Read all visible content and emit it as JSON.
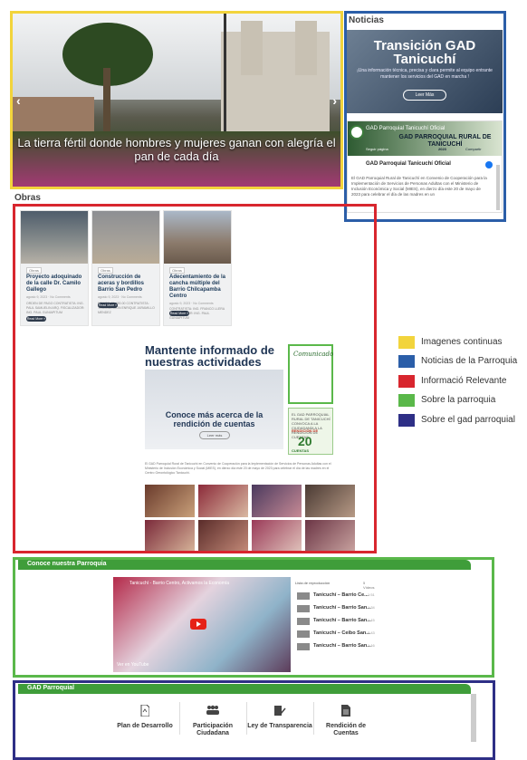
{
  "hero": {
    "caption": "La tierra fértil donde hombres y mujeres ganan con alegría el pan de cada día",
    "prev_arrow": "‹",
    "next_arrow": "›"
  },
  "noticias": {
    "title": "Noticias",
    "banner_title": "Transición GAD Tanicuchí",
    "banner_subtitle": "¡Una información técnica, precisa y clara permite al equipo entrante mantener los servicios del GAD en marcha !",
    "banner_button": "Leer Más",
    "fb_page_name": "GAD Parroquial Tanicuchí Oficial",
    "fb_headline": "GAD PARROQUIAL RURAL DE TANICUCHÍ",
    "fb_follow": "Seguir página",
    "fb_share": "Compartir",
    "fb_year": "2023",
    "fb_post_author": "GAD Parroquial Tanicuchí Oficial",
    "fb_post_text": "El GAD Parroquial Rural de Tanicuchí en Convenio de Cooperación para la Implementación de Servicios de Personas Adultas con el Ministerio de Inclusión Económica y Social (MIES), en dierzo día este 20 de mayo de 2023 para celebrar el día de las madres en un"
  },
  "obras": {
    "title": "Obras",
    "read_more": "Read More »",
    "cards": [
      {
        "tag": "Obras",
        "title": "Proyecto adoquinado de la calle Dr. Camilo Gallego",
        "meta": "agosto 9, 2023 · No Comments",
        "text": "ORDEN DE PAGO CONTRATISTA: ING. PAUL SAMUELIN ARQ. FISCALIZADOR: ING. PAUL GUNIAPITUM"
      },
      {
        "tag": "Obras",
        "title": "Construcción de aceras y bordillos Barrio San Pedro",
        "meta": "agosto 9, 2023 · No Comments",
        "text": "MONTO: 51,490.00 CONTRATISTA: TRANSACCIÓN ENRIQUE JARAMILLO MENDEZ"
      },
      {
        "tag": "Obras",
        "title": "Adecentamiento de la cancha múltiple del Barrio Chilcapamba Centro",
        "meta": "agosto 9, 2023 · No Comments",
        "text": "CONTRATISTA: ING. FRANCO LLERA FISCALIZADOR: ING. PAUL GUNIAPITUM"
      }
    ]
  },
  "informacion": {
    "heading": "Mantente informado de nuestras actividades",
    "rendicion_title": "Conoce más acerca de la rendición de cuentas",
    "rendicion_button": "Leer más",
    "comunicado": "Comunicado",
    "poster_text": "EL GAD PARROQUIAL RURAL DE TANICUCHÍ CONVOCA A LA CIUDADANÍA A LA RENDICIÓN DE CUENTAS",
    "poster_label": "RENDICIÓN DE",
    "poster_number": "20",
    "poster_sub": "CUENTAS",
    "paragraph": "El GAD Parroquial Rural de Tanicuchí en Convenio de Cooperación para la Implementación de Servicios de Personas Adultas con el Ministerio de Inclusión Económica y Social (MIES), en dierzo día este 20 de mayo de 2023 para celebrar el día de las madres en el Centro Gerontológico Tanicuchí."
  },
  "legend": [
    {
      "label": "Imagenes continuas",
      "color": "#f2d43c"
    },
    {
      "label": "Noticias de la Parroquia",
      "color": "#2b5ea8"
    },
    {
      "label": "Informació Relevante",
      "color": "#d8262e"
    },
    {
      "label": "Sobre la parroquia",
      "color": "#5ab84a"
    },
    {
      "label": "Sobre el gad parroquial",
      "color": "#2e2f86"
    }
  ],
  "parroquia": {
    "title": "Conoce nuestra Parroquia",
    "video_title": "Tanicuchí - Barrio Centro, Activamos la Economía",
    "watch_on": "Ver en YouTube",
    "playlist_header": "Lista de reproducción",
    "playlist_count": "5 Vídeos",
    "playlist": [
      {
        "title": "Tanicuchí – Barrio Ce...",
        "duration": "1:51"
      },
      {
        "title": "Tanicuchí – Barrio San...",
        "duration": "1:34"
      },
      {
        "title": "Tanicuchí – Barrio San...",
        "duration": "1:15"
      },
      {
        "title": "Tanicuchí – Ceibo San...",
        "duration": "0:43"
      },
      {
        "title": "Tanicuchí – Barrio San...",
        "duration": "1:16"
      }
    ]
  },
  "gad": {
    "title": "GAD Parroquial",
    "items": [
      {
        "label": "Plan de Desarrollo",
        "icon": "document-icon"
      },
      {
        "label": "Participación Ciudadana",
        "icon": "people-icon"
      },
      {
        "label": "Ley de Transparencia",
        "icon": "signature-icon"
      },
      {
        "label": "Rendición de Cuentas",
        "icon": "file-icon"
      }
    ]
  }
}
